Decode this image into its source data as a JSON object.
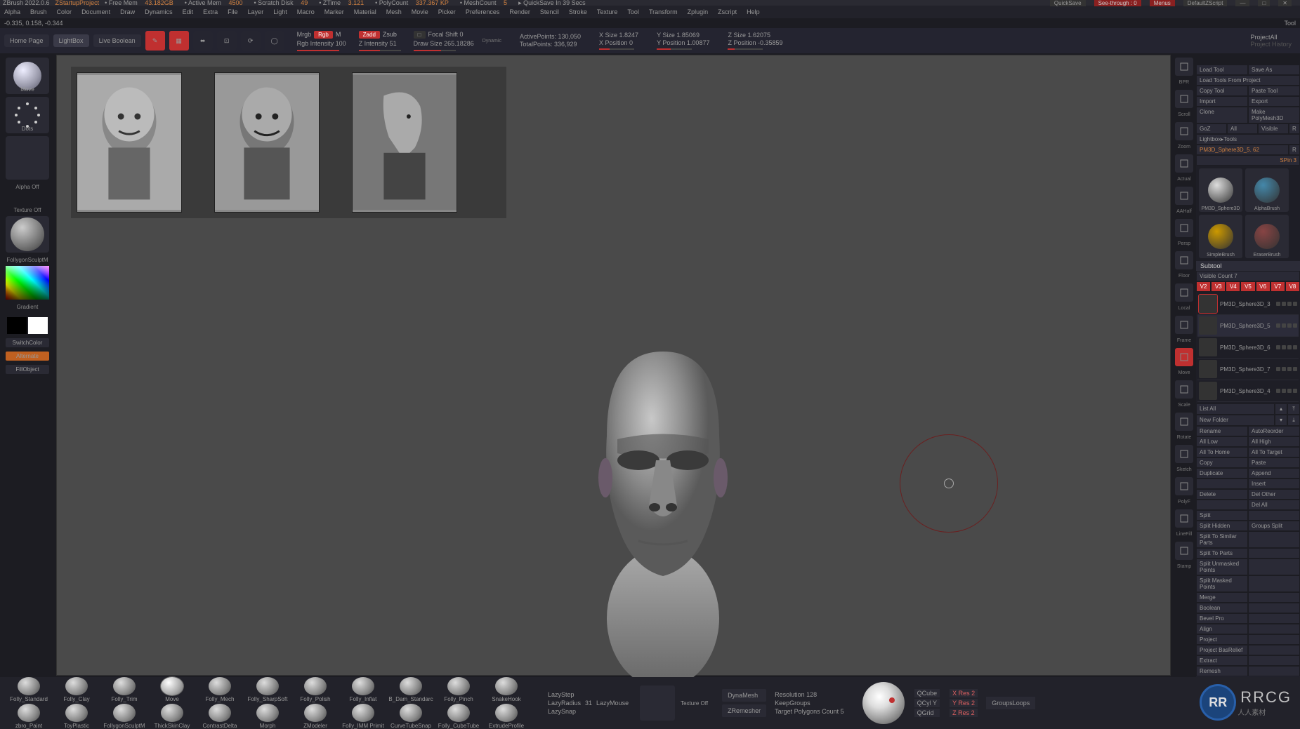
{
  "title": {
    "app": "ZBrush 2022.0.6",
    "project": "ZStartupProject",
    "mem_label": "Free Mem",
    "mem": "43.182GB",
    "active_label": "Active Mem",
    "active": "4500",
    "scratch_label": "Scratch Disk",
    "scratch": "49",
    "ztime_label": "ZTime",
    "ztime": "3.121",
    "poly_label": "PolyCount",
    "poly": "337.367 KP",
    "mesh_label": "MeshCount",
    "mesh": "5",
    "quicksave": "QuickSave In 39 Secs",
    "quicksave_btn": "QuickSave",
    "seethrough": "See-through : 0",
    "menus": "Menus",
    "defaultscript": "DefaultZScript"
  },
  "menu": [
    "Alpha",
    "Brush",
    "Color",
    "Document",
    "Draw",
    "Dynamics",
    "Edit",
    "Extra",
    "File",
    "Layer",
    "Light",
    "Macro",
    "Marker",
    "Material",
    "Mesh",
    "Movie",
    "Picker",
    "Preferences",
    "Render",
    "Stencil",
    "Stroke",
    "Texture",
    "Tool",
    "Transform",
    "Zplugin",
    "Zscript",
    "Help"
  ],
  "coord": "-0.335, 0.158, -0.344",
  "toolbar": {
    "tabs": [
      "Home Page",
      "LightBox",
      "Live Boolean"
    ],
    "mrgb": "Mrgb",
    "rgb": "Rgb",
    "m": "M",
    "zadd": "Zadd",
    "zsub": "Zsub",
    "focal_label": "Focal Shift 0",
    "rgb_int": "Rgb Intensity 100",
    "z_int": "Z Intensity 51",
    "draw_size": "Draw Size 265.18286",
    "dynamic": "Dynamic",
    "active_pts": "ActivePoints: 130,050",
    "total_pts": "TotalPoints: 336,929",
    "xsize": "X Size 1.8247",
    "xpos": "X Position 0",
    "ysize": "Y Size 1.85069",
    "ypos": "Y Position 1.00877",
    "zsize": "Z Size 1.62075",
    "zpos": "Z Position -0.35859",
    "proj_all": "ProjectAll",
    "proj_hist": "Project History"
  },
  "left": {
    "brush": "Move",
    "stroke": "Dots",
    "alpha": "Alpha Off",
    "texture": "Texture Off",
    "material": "FollygonSculptM",
    "gradient": "Gradient",
    "switch": "SwitchColor",
    "alternate": "Alternate",
    "fill": "FillObject"
  },
  "right_icons": [
    "BPR",
    "Scroll",
    "Zoom",
    "Actual",
    "AAHalf",
    "Persp",
    "Floor",
    "Local",
    "Frame",
    "Move",
    "Scale",
    "Rotate",
    "Sketch",
    "PolyF",
    "LineFill",
    "Stamp"
  ],
  "tool_panel": {
    "header": "Tool",
    "actions1": [
      "Load Tool",
      "Save As"
    ],
    "actions2": [
      "Load Tools From Project"
    ],
    "actions3": [
      "Copy Tool",
      "Paste Tool"
    ],
    "actions4": [
      "Import",
      "Export"
    ],
    "actions5": [
      "Clone",
      "Make PolyMesh3D"
    ],
    "actions6": [
      "GoZ",
      "All",
      "Visible",
      "R"
    ],
    "lightbox": "Lightbox▸Tools",
    "current": "PM3D_Sphere3D_5. 62",
    "spin": "SPin  3",
    "r": "R",
    "thumbs": [
      "PM3D_Sphere3D",
      "AlphaBrush",
      "SimpleBrush",
      "EraserBrush"
    ],
    "subtool_hdr": "Subtool",
    "visible_count": "Visible Count 7",
    "layers": [
      "V2",
      "V3",
      "V4",
      "V5",
      "V6",
      "V7",
      "V8"
    ],
    "items": [
      "PM3D_Sphere3D_3",
      "PM3D_Sphere3D_5",
      "PM3D_Sphere3D_6",
      "PM3D_Sphere3D_7",
      "PM3D_Sphere3D_4"
    ],
    "listall": "List All",
    "newfolder": "New Folder",
    "ops": [
      [
        "Rename",
        "AutoReorder"
      ],
      [
        "All Low",
        "All High"
      ],
      [
        "All To Home",
        "All To Target"
      ],
      [
        "Copy",
        "Paste"
      ],
      [
        "Duplicate",
        "Append"
      ],
      [
        "",
        "Insert"
      ],
      [
        "Delete",
        "Del Other"
      ],
      [
        "",
        "Del All"
      ],
      [
        "Split",
        ""
      ],
      [
        "Split Hidden",
        "Groups Split"
      ],
      [
        "Split To Similar Parts",
        ""
      ],
      [
        "Split To Parts",
        ""
      ],
      [
        "Split Unmasked Points",
        ""
      ],
      [
        "Split Masked Points",
        ""
      ],
      [
        "Merge",
        ""
      ],
      [
        "Boolean",
        ""
      ],
      [
        "Bevel Pro",
        ""
      ],
      [
        "Align",
        ""
      ],
      [
        "Project",
        ""
      ],
      [
        "Project BasRelief",
        ""
      ],
      [
        "Extract",
        ""
      ],
      [
        "Remesh",
        ""
      ]
    ]
  },
  "bottom": {
    "brushes_row1": [
      "Folly_Standard",
      "Folly_Clay",
      "Folly_Trim",
      "Move",
      "Folly_Mech",
      "Folly_SharpSoft",
      "Folly_Polish",
      "Folly_Inflat",
      "B_Dam_Standarc",
      "Folly_Pinch",
      "SnakeHook"
    ],
    "brushes_row2": [
      "zbro_Paint",
      "ToyPlastic",
      "FollygonSculptM",
      "ThickSkinClay",
      "ContrastDelta",
      "Morph",
      "ZModeler",
      "Folly_IMM Primit",
      "CurveTubeSnap",
      "Folly_CubeTube",
      "ExtrudeProfile"
    ],
    "lazy": [
      "LazyStep",
      "LazyRadius",
      "LazySnap"
    ],
    "lazy_vals": [
      "",
      "31",
      ""
    ],
    "lazymouse": "LazyMouse",
    "texture_off": "Texture Off",
    "dynamesh": "DynaMesh",
    "zremesher": "ZRemesher",
    "resolution": "Resolution  128",
    "keepgroups": "KeepGroups",
    "target": "Target Polygons Count 5",
    "qgrid": [
      "QCube",
      "QCyl Y",
      "QGrid"
    ],
    "qvals": [
      "X Res 2",
      "Y Res 2",
      "Z Res 2"
    ],
    "groupsloops": "GroupsLoops"
  },
  "watermark": {
    "logo": "RR",
    "text": "RRCG",
    "cn": "人人素材"
  }
}
